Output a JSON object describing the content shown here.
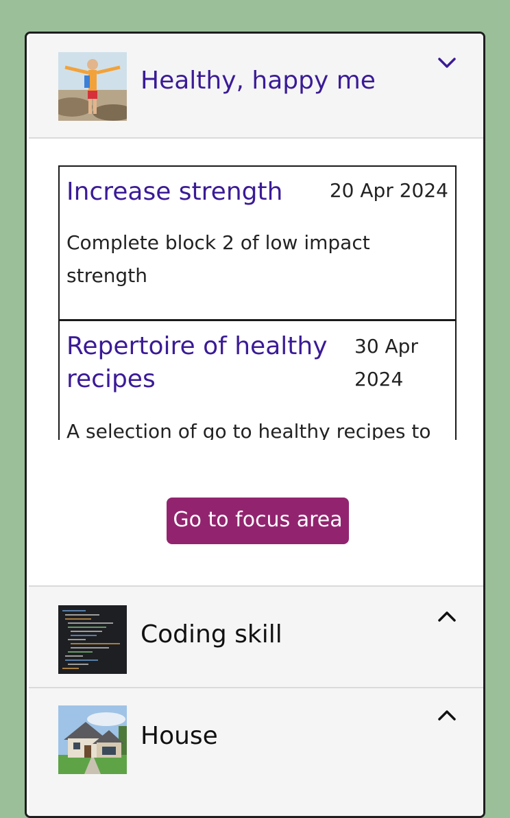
{
  "focus_areas": [
    {
      "title": "Healthy, happy me",
      "thumbnail_icon": "person-outdoors-photo",
      "chevron_icon": "chevron-down-icon",
      "goals": [
        {
          "title": "Increase strength",
          "date": "20 Apr 2024",
          "description": "Complete block 2 of low impact strength"
        },
        {
          "title": "Repertoire of healthy recipes",
          "date": "30 Apr 2024",
          "description": "A selection of go to healthy recipes to"
        }
      ],
      "button_label": "Go to focus area"
    },
    {
      "title": "Coding skill",
      "thumbnail_icon": "code-editor-photo",
      "chevron_icon": "chevron-up-icon"
    },
    {
      "title": "House",
      "thumbnail_icon": "house-photo",
      "chevron_icon": "chevron-up-icon"
    }
  ],
  "colors": {
    "page_background": "#9abf99",
    "accent_title": "#3a1b96",
    "button": "#92246f",
    "header_background": "#f5f5f5"
  }
}
